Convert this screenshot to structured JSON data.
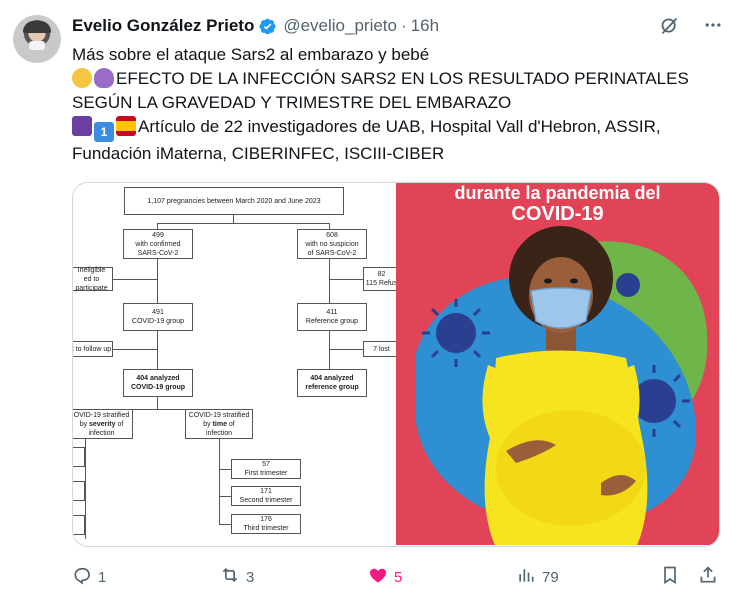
{
  "author": {
    "name": "Evelio González Prieto",
    "handle": "@evelio_prieto",
    "separator": "·",
    "time": "16h"
  },
  "text": {
    "line1": "Más sobre el ataque Sars2 al embarazo y bebé",
    "line2": "EFECTO DE LA INFECCIÓN SARS2 EN LOS RESULTADO PERINATALES",
    "line3": "SEGÚN LA GRAVEDAD Y TRIMESTRE DEL EMBARAZO",
    "line4": "Artículo de 22 investigadores de UAB, Hospital Vall d'Hebron, ASSIR,",
    "line5": "Fundación iMaterna,  CIBERINFEC, ISCIII-CIBER"
  },
  "emojis": {
    "line2": [
      "baby-emoji",
      "pregnant-woman-emoji"
    ],
    "line4": [
      "books-emoji",
      "keycap-one-emoji",
      "spain-flag-emoji"
    ]
  },
  "flowchart": {
    "total": "1,107 pregnancies between March 2020 and June 2023",
    "confirmed_n": "499",
    "confirmed_text": "with confirmed",
    "confirmed_text2": "SARS-CoV-2",
    "nosusp_n": "608",
    "nosusp_text": "with no suspicion",
    "nosusp_text2": "of SARS-CoV-2",
    "ineligible_1": "Ineligible",
    "ineligible_2": "ed to participate",
    "refused_n": "82",
    "refused_text": "115 Refus",
    "covid_group_n": "491",
    "covid_group": "COVID-19 group",
    "ref_group_n": "411",
    "ref_group": "Reference group",
    "lost_left": "t to follow up",
    "lost_right": "7 lost",
    "analyzed_covid_1": "404 analyzed",
    "analyzed_covid_2": "COVID-19 group",
    "analyzed_ref_1": "404 analyzed",
    "analyzed_ref_2": "reference group",
    "strat_sev_1": "OVID-19 stratified",
    "strat_sev_2_pre": "by ",
    "strat_sev_2_bold": "severity",
    "strat_sev_2_post": " of",
    "strat_sev_3": "infection",
    "strat_time_1": "COVID-19 stratified",
    "strat_time_2_pre": "by ",
    "strat_time_2_bold": "time",
    "strat_time_2_post": " of",
    "strat_time_3": "infection",
    "t1_n": "57",
    "t1": "First trimester",
    "t2_n": "171",
    "t2": "Second trimester",
    "t3_n": "176",
    "t3": "Third trimester"
  },
  "poster": {
    "title1": "durante la pandemia del",
    "title2": "COVID-19"
  },
  "actions": {
    "replies": "1",
    "reposts": "3",
    "likes": "5",
    "views": "79"
  },
  "colors": {
    "accent": "#1d9bf0",
    "like": "#f91880",
    "muted": "#536471",
    "poster_bg": "#e04456"
  }
}
